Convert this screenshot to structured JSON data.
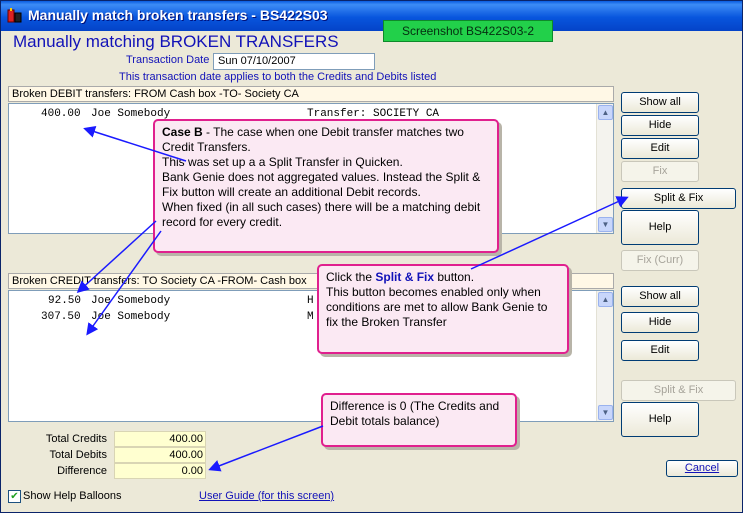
{
  "window": {
    "title": "Manually match broken transfers - BS422S03"
  },
  "screenshot_tag": "Screenshot BS422S03-2",
  "heading": "Manually matching BROKEN TRANSFERS",
  "transaction_date": {
    "label": "Transaction Date",
    "value": "Sun 07/10/2007",
    "note": "This transaction date applies to both the Credits and Debits listed"
  },
  "debit_panel": {
    "header": "Broken DEBIT transfers: FROM Cash box -TO- Society CA",
    "rows": [
      {
        "amount": "400.00",
        "name": "Joe Somebody",
        "memo": "Transfer: SOCIETY CA"
      }
    ]
  },
  "credit_panel": {
    "header": "Broken CREDIT transfers: TO Society CA -FROM- Cash box",
    "rows": [
      {
        "amount": "92.50",
        "name": "Joe Somebody",
        "memo": "H"
      },
      {
        "amount": "307.50",
        "name": "Joe Somebody",
        "memo": "M"
      }
    ]
  },
  "debit_buttons": {
    "show_all": "Show all",
    "hide": "Hide",
    "edit": "Edit",
    "fix": "Fix",
    "split_fix": "Split & Fix",
    "help": "Help"
  },
  "credit_buttons": {
    "fix_curr": "Fix (Curr)",
    "show_all": "Show all",
    "hide": "Hide",
    "edit": "Edit",
    "split_fix": "Split & Fix",
    "help": "Help"
  },
  "totals": {
    "credits_label": "Total Credits",
    "credits_value": "400.00",
    "debits_label": "Total Debits",
    "debits_value": "400.00",
    "difference_label": "Difference",
    "difference_value": "0.00"
  },
  "footer": {
    "show_help_label": "Show Help Balloons",
    "show_help_checked": true,
    "user_guide_link": "User Guide (for this screen)",
    "cancel": "Cancel"
  },
  "callouts": {
    "case_b_title": "Case B",
    "case_b_rest": " - The case when one Debit transfer matches two Credit Transfers.",
    "case_b_line2": "This was set up a a Split Transfer in Quicken.",
    "case_b_line3": "Bank Genie does not aggregated values. Instead the Split & Fix button will create an additional Debit records.",
    "case_b_line4": "When fixed (in all such cases) there will be a matching debit record for every credit.",
    "split_pre": "Click the ",
    "split_bold": "Split & Fix",
    "split_post": " button.",
    "split_rest": "This button becomes enabled only when conditions are met to allow Bank Genie to fix the Broken Transfer",
    "difference": "Difference is 0 (The Credits and Debit totals balance)"
  },
  "colors": {
    "accent_blue": "#1212b8",
    "callout_border": "#e0208e",
    "arrow": "#1a1aff"
  }
}
